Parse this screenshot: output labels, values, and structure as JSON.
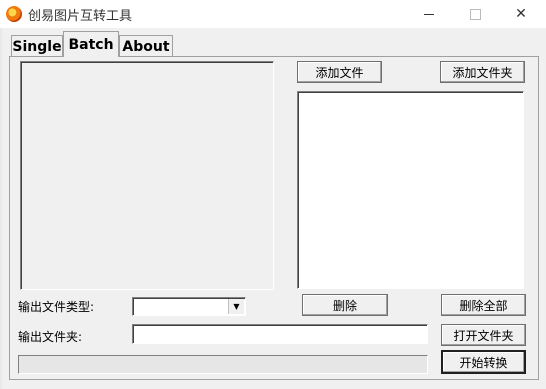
{
  "window": {
    "title": "创易图片互转工具",
    "minimize_glyph": "—",
    "maximize_glyph": "☐",
    "close_glyph": "✕"
  },
  "tabs": [
    {
      "label": "Single",
      "selected": false
    },
    {
      "label": "Batch",
      "selected": true
    },
    {
      "label": "About",
      "selected": false
    }
  ],
  "batch": {
    "add_file_label": "添加文件",
    "add_folder_label": "添加文件夹",
    "delete_label": "删除",
    "delete_all_label": "删除全部",
    "output_type_label": "输出文件类型:",
    "output_type_value": "",
    "output_folder_label": "输出文件夹:",
    "output_folder_value": "",
    "open_folder_label": "打开文件夹",
    "start_label": "开始转换",
    "progress": 0,
    "file_list": []
  },
  "colors": {
    "window_bg": "#f0f0f0",
    "titlebar_bg": "#ffffff",
    "list_bg": "#ffffff"
  },
  "icons": [
    "app-logo-icon",
    "minimize-icon",
    "maximize-icon",
    "close-icon",
    "dropdown-arrow-icon"
  ]
}
